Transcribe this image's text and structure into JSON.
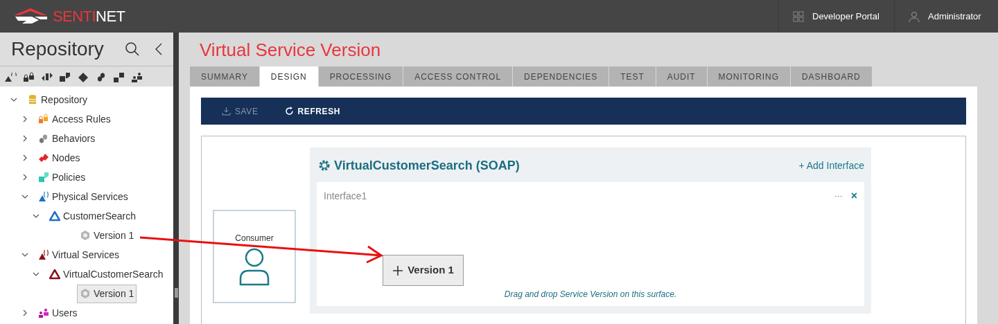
{
  "header": {
    "logo": {
      "accent": "SENTI",
      "rest": "NET"
    },
    "links": [
      {
        "kind": "portal",
        "label": "Developer Portal"
      },
      {
        "kind": "user",
        "label": "Administrator"
      }
    ]
  },
  "sidebar": {
    "title": "Repository",
    "tree": [
      {
        "label": "Repository",
        "expanded": true,
        "selected": false,
        "children": [
          {
            "label": "Access Rules",
            "expanded": false,
            "selected": false
          },
          {
            "label": "Behaviors",
            "expanded": false,
            "selected": false
          },
          {
            "label": "Nodes",
            "expanded": false,
            "selected": false
          },
          {
            "label": "Policies",
            "expanded": false,
            "selected": false
          },
          {
            "label": "Physical Services",
            "expanded": true,
            "selected": false,
            "children": [
              {
                "label": "CustomerSearch",
                "expanded": true,
                "selected": false,
                "children": [
                  {
                    "label": "Version 1",
                    "selected": false
                  }
                ]
              }
            ]
          },
          {
            "label": "Virtual Services",
            "expanded": true,
            "selected": false,
            "children": [
              {
                "label": "VirtualCustomerSearch",
                "expanded": true,
                "selected": false,
                "children": [
                  {
                    "label": "Version 1",
                    "selected": true
                  }
                ]
              }
            ]
          },
          {
            "label": "Users",
            "expanded": false,
            "selected": false
          }
        ]
      }
    ]
  },
  "page": {
    "title": "Virtual Service Version",
    "tabs": [
      {
        "label": "SUMMARY",
        "selected": false
      },
      {
        "label": "DESIGN",
        "selected": true
      },
      {
        "label": "PROCESSING",
        "selected": false
      },
      {
        "label": "ACCESS CONTROL",
        "selected": false
      },
      {
        "label": "DEPENDENCIES",
        "selected": false
      },
      {
        "label": "TEST",
        "selected": false
      },
      {
        "label": "AUDIT",
        "selected": false
      },
      {
        "label": "MONITORING",
        "selected": false
      },
      {
        "label": "DASHBOARD",
        "selected": false
      }
    ],
    "toolbar": [
      {
        "kind": "save",
        "label": "SAVE",
        "disabled": true
      },
      {
        "kind": "refresh",
        "label": "REFRESH",
        "disabled": false
      }
    ],
    "consumer": {
      "label": "Consumer"
    },
    "service": {
      "title": "VirtualCustomerSearch (SOAP)",
      "add_interface": "+ Add Interface",
      "interface": {
        "name": "Interface1",
        "menu": "···",
        "close": "×",
        "version_button": "Version 1",
        "hint": "Drag and drop Service Version on this surface."
      }
    }
  }
}
